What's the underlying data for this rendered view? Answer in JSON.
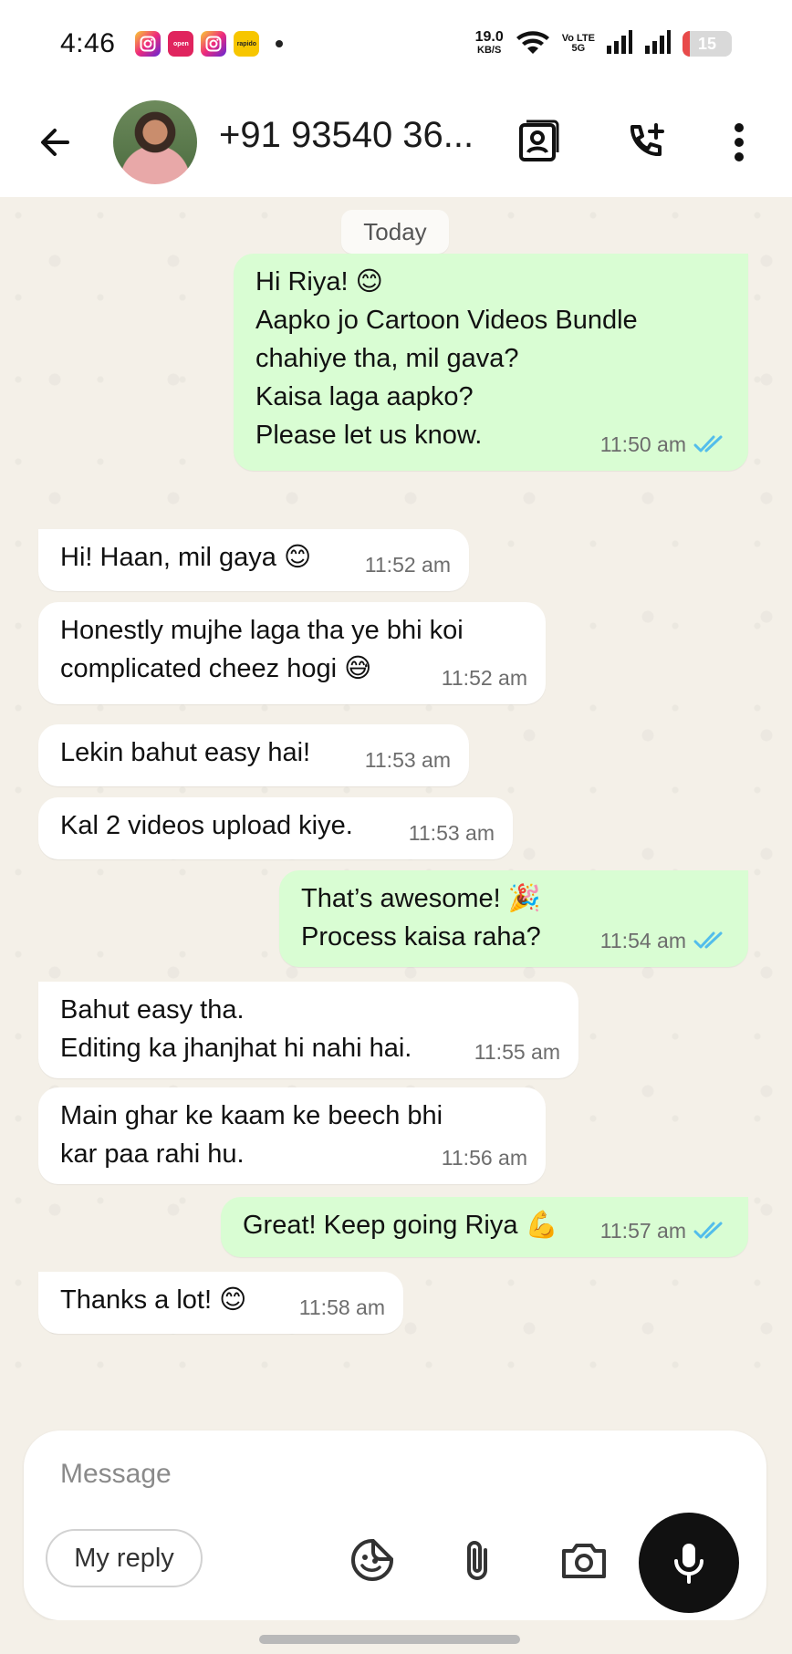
{
  "status_bar": {
    "time": "4:46",
    "notifications": [
      "instagram-icon",
      "chat-icon",
      "open-icon",
      "instagram-icon",
      "rapido-icon"
    ],
    "open_label": "open",
    "rapido_label": "rapido",
    "net_speed": "19.0",
    "net_unit": "KB/S",
    "volte_top": "Vo LTE",
    "volte_bottom": "5G",
    "battery": "15",
    "battery_level": 0.15,
    "battery_color": "#e84a4a"
  },
  "header": {
    "contact_name": "+91 93540 36...",
    "icons": [
      "back-arrow-icon",
      "contact-card-icon",
      "call-add-icon",
      "more-vert-icon"
    ]
  },
  "chat": {
    "date_chip": "Today",
    "messages": [
      {
        "dir": "out",
        "text": "Hi Riya! 😊\nAapko jo Cartoon Videos Bundle\nchahiye tha, mil gava?\nKaisa laga aapko?\nPlease let us know.",
        "time": "11:50 am",
        "read": true
      },
      {
        "dir": "in",
        "text": "Hi! Haan, mil gaya 😊",
        "time": "11:52 am"
      },
      {
        "dir": "in",
        "text": "Honestly mujhe laga tha ye bhi koi\ncomplicated cheez hogi 😅",
        "time": "11:52 am"
      },
      {
        "dir": "in",
        "text": "Lekin bahut easy hai!",
        "time": "11:53 am"
      },
      {
        "dir": "in",
        "text": "Kal 2 videos upload kiye.",
        "time": "11:53 am"
      },
      {
        "dir": "out",
        "text": "That’s awesome! 🎉\nProcess kaisa raha?",
        "time": "11:54 am",
        "read": true
      },
      {
        "dir": "in",
        "text": "Bahut easy tha.\nEditing ka jhanjhat hi nahi hai.",
        "time": "11:55 am"
      },
      {
        "dir": "in",
        "text": "Main ghar ke kaam ke beech bhi\nkar paa rahi hu.",
        "time": "11:56 am"
      },
      {
        "dir": "out",
        "text": "Great! Keep going Riya 💪",
        "time": "11:57 am",
        "read": true
      },
      {
        "dir": "in",
        "text": "Thanks a lot! 😊",
        "time": "11:58 am"
      }
    ],
    "read_tick_color": "#53bdeb",
    "outgoing_color": "#d9fdd3",
    "incoming_color": "#ffffff"
  },
  "composer": {
    "placeholder": "Message",
    "reply_chip": "My reply",
    "icons": [
      "sticker-icon",
      "attach-icon",
      "camera-icon",
      "mic-icon"
    ]
  }
}
